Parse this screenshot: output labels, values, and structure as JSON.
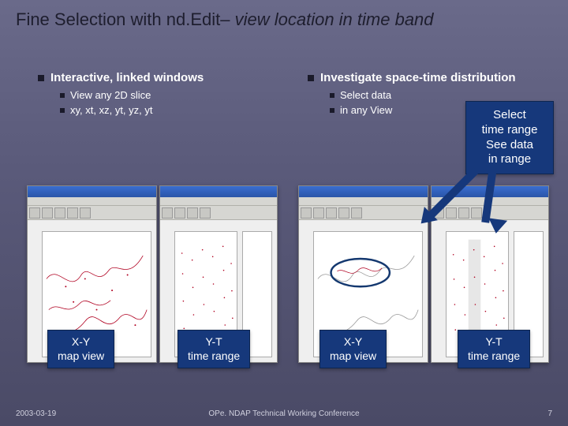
{
  "title": {
    "prefix": "Fine Selection with nd.Edit– ",
    "suffix": "view location in time band"
  },
  "left_bullets": {
    "h": "Interactive, linked windows",
    "items": [
      "View any 2D slice",
      "xy, xt, xz, yt, yz, yt"
    ]
  },
  "right_bullets": {
    "h": "Investigate space-time distribution",
    "items": [
      "Select data",
      "in any View"
    ]
  },
  "callouts": {
    "top_right_l1": "Select",
    "top_right_l2": "time range",
    "top_right_l3": "See data",
    "top_right_l4": "in range",
    "bl_l1": "X-Y",
    "bl_l2": "map view",
    "bm_l1": "Y-T",
    "bm_l2": "time range",
    "br_l1": "X-Y",
    "br_l2": "map view",
    "brr_l1": "Y-T",
    "brr_l2": "time range"
  },
  "footer": {
    "date": "2003-03-19",
    "center": "OPe. NDAP Technical Working Conference",
    "page": "7"
  }
}
